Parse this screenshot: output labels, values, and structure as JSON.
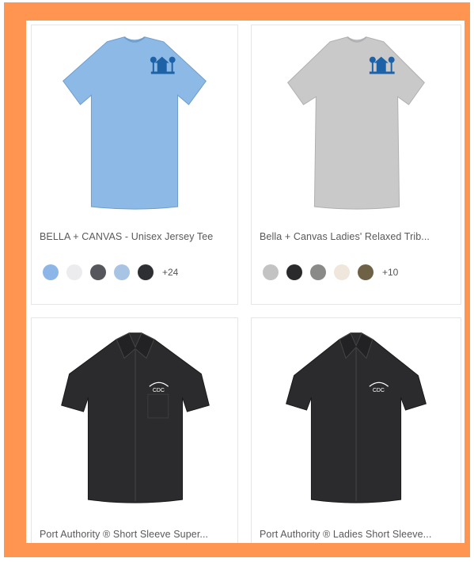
{
  "products": [
    {
      "name": "BELLA + CANVAS - Unisex Jersey Tee",
      "garment": "tshirt",
      "shirt_color": "#8db9e6",
      "logo_color": "#1d62a7",
      "swatches": [
        "#8cb6e8",
        "#ececee",
        "#55575c",
        "#a8c4e4",
        "#2e2f33"
      ],
      "more": "+24"
    },
    {
      "name": "Bella + Canvas Ladies' Relaxed Trib...",
      "garment": "tshirt",
      "shirt_color": "#c9c9ca",
      "logo_color": "#1d62a7",
      "swatches": [
        "#c3c3c3",
        "#2a2a2d",
        "#8a8b88",
        "#efe6dc",
        "#6f6146"
      ],
      "more": "+10"
    },
    {
      "name": "Port Authority ® Short Sleeve Super...",
      "garment": "shirt",
      "shirt_color": "#2b2b2d",
      "logo_color": "#ffffff",
      "logo_text": "CDC"
    },
    {
      "name": "Port Authority ® Ladies Short Sleeve...",
      "garment": "shirt",
      "shirt_color": "#2b2b2d",
      "logo_color": "#ffffff",
      "logo_text": "CDC"
    }
  ]
}
